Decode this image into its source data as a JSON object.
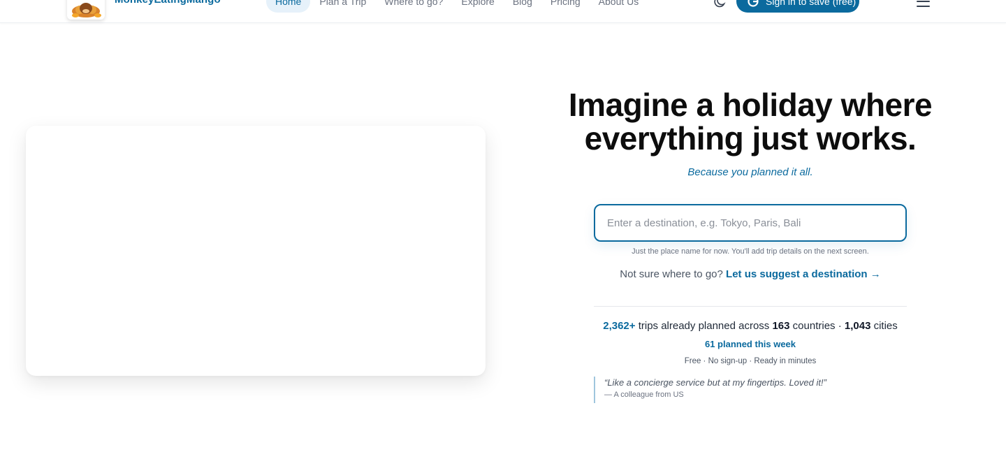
{
  "header": {
    "brand": "MonkeyEatingMango",
    "logo_icon": "monkey-mango-logo",
    "nav": [
      {
        "label": "Home",
        "active": true
      },
      {
        "label": "Plan a Trip",
        "active": false
      },
      {
        "label": "Where to go?",
        "active": false
      },
      {
        "label": "Explore",
        "active": false
      },
      {
        "label": "Blog",
        "active": false
      },
      {
        "label": "Pricing",
        "active": false
      },
      {
        "label": "About Us",
        "active": false
      }
    ],
    "theme_icon": "moon-icon",
    "signin_label": "Sign in to save (free)",
    "signin_icon": "google-icon",
    "menu_icon": "hamburger-menu-icon"
  },
  "hero": {
    "title_line1": "Imagine a holiday where",
    "title_line2": "everything just works.",
    "subtitle": "Because you planned it all.",
    "input_placeholder": "Enter a destination, e.g. Tokyo, Paris, Bali",
    "input_value": "",
    "hint": "Just the place name for now. You'll add trip details on the next screen.",
    "suggest_prefix": "Not sure where to go?",
    "suggest_link": "Let us suggest a destination →"
  },
  "stats": {
    "trips": "2,362+",
    "trips_text": " trips already planned across ",
    "countries": "163",
    "countries_text": " countries · ",
    "cities": "1,043",
    "cities_text": " cities",
    "this_week": "61 planned this week",
    "meta": "Free · No sign-up · Ready in minutes"
  },
  "testimonial": {
    "quote": "“Like a concierge service but at my fingertips. Loved it!”",
    "author": "— A colleague from US"
  },
  "colors": {
    "accent": "#0b6a9e",
    "accent_light": "#e6f1fa"
  }
}
